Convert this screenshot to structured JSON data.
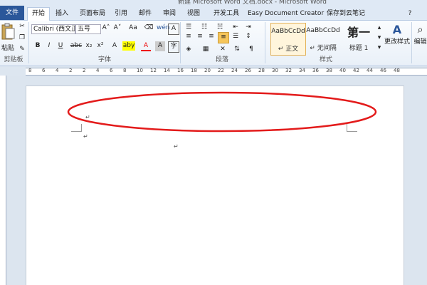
{
  "window": {
    "title": "新建 Microsoft Word 文档.docx - Microsoft Word"
  },
  "tabs": [
    "文件",
    "开始",
    "插入",
    "页面布局",
    "引用",
    "邮件",
    "审阅",
    "视图",
    "开发工具",
    "Easy Document Creator",
    "保存到云笔记"
  ],
  "clipboard": {
    "paste_label": "粘贴",
    "group_label": "剪贴板"
  },
  "font": {
    "name": "Calibri (西文正文)",
    "size": "五号",
    "group_label": "字体",
    "bold": "B",
    "italic": "I",
    "underline": "U",
    "strike": "abc",
    "subscript": "x₂",
    "superscript": "x²",
    "grow": "A˄",
    "shrink": "A˅",
    "case": "Aa",
    "highlight": "aby",
    "color": "A",
    "pinyin": "wén",
    "charborder": "A"
  },
  "paragraph": {
    "group_label": "段落"
  },
  "styles": {
    "group_label": "样式",
    "items": [
      {
        "sample": "AaBbCcDd",
        "name": "↵ 正文"
      },
      {
        "sample": "AaBbCcDd",
        "name": "↵ 无间隔"
      },
      {
        "sample": "第一",
        "name": "标题 1"
      }
    ],
    "change_label": "更改样式"
  },
  "editing": {
    "label": "编辑"
  },
  "ruler": {
    "labels": [
      "8",
      "6",
      "4",
      "2",
      "2",
      "4",
      "6",
      "8",
      "10",
      "12",
      "14",
      "16",
      "18",
      "20",
      "22",
      "24",
      "26",
      "28",
      "30",
      "32",
      "34",
      "36",
      "38",
      "40",
      "42",
      "44",
      "46",
      "48"
    ]
  },
  "document": {
    "paragraph_mark": "↵"
  },
  "annotation": {
    "color": "#e31b1b"
  }
}
